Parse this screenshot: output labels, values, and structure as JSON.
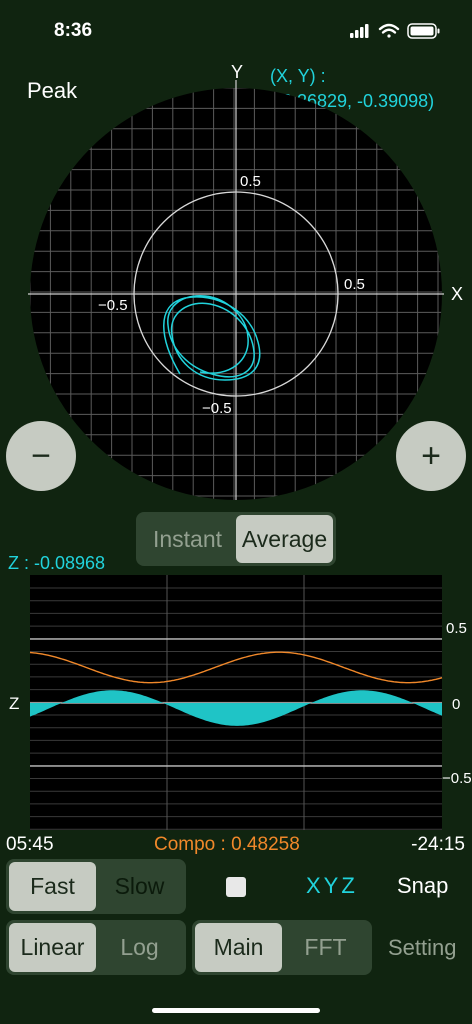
{
  "status_bar": {
    "time": "8:36",
    "icons": [
      "signal-icon",
      "wifi-icon",
      "battery-icon"
    ]
  },
  "mode_title": "Peak",
  "xy_readout": {
    "label": "(X, Y)  :",
    "value": "(-0.26829, -0.39098)"
  },
  "polar_plot": {
    "axis_x": "X",
    "axis_y": "Y",
    "ticks": {
      "top": "0.5",
      "right": "0.5",
      "left": "−0.5",
      "bottom": "−0.5"
    }
  },
  "zoom": {
    "minus_label": "−",
    "plus_label": "+"
  },
  "averaging": {
    "options": [
      "Instant",
      "Average"
    ],
    "selected": "Average"
  },
  "z_readout": "Z : -0.08968",
  "strip_chart": {
    "axis_label": "Z",
    "ticks": [
      "0.5",
      "0",
      "−0.5"
    ],
    "time_start": "05:45",
    "time_end": "-24:15",
    "compo": "Compo : 0.48258"
  },
  "speed": {
    "options": [
      "Fast",
      "Slow"
    ],
    "selected": "Fast"
  },
  "axes_toggle": {
    "label": "XYZ",
    "checked": false
  },
  "snap_label": "Snap",
  "scale": {
    "options": [
      "Linear",
      "Log"
    ],
    "selected": "Linear"
  },
  "view": {
    "options": [
      "Main",
      "FFT"
    ],
    "selected": "Main"
  },
  "setting_label": "Setting",
  "colors": {
    "background": "#102410",
    "cyan": "#21d3dc",
    "orange": "#f0882a",
    "button": "#c6cbc2"
  }
}
